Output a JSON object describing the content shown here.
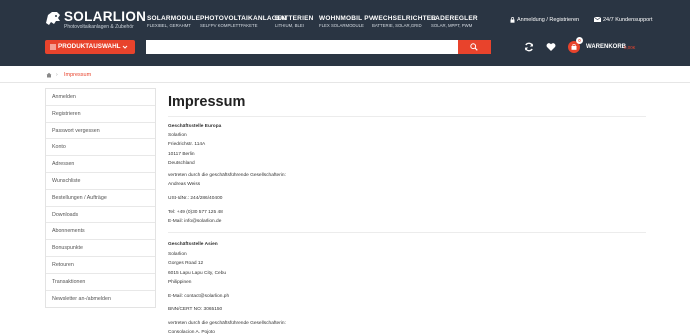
{
  "brand": {
    "name": "SOLARLION",
    "tagline": "Photovoltaikanlagen & Zubehör"
  },
  "nav": [
    {
      "title": "SOLARMODULE",
      "sub": "FLEXIBEL, GERAHMT"
    },
    {
      "title": "PHOTOVOLTAIKANLAGEN",
      "sub": "SELFPV KOMPLETTPAKETE"
    },
    {
      "title": "BATTERIEN",
      "sub": "LITHIUM, BLEI"
    },
    {
      "title": "WOHNMOBIL PV",
      "sub": "FLEX SOLARMODULE"
    },
    {
      "title": "WECHSELRICHTER",
      "sub": "BATTERIE, SOLAR,GRID"
    },
    {
      "title": "LADEREGLER",
      "sub": "SOLAR, MPPT, PWM"
    }
  ],
  "top_links": {
    "login": "Anmeldung / Registrieren",
    "support": "24/7 Kundensupport"
  },
  "toolbar": {
    "product_button": "PRODUKTAUSWAHL",
    "search_placeholder": "",
    "cart_label": "WARENKORB",
    "cart_count": "0",
    "cart_price": "0,00€"
  },
  "breadcrumb": {
    "current": "Impressum"
  },
  "sidebar": [
    "Anmelden",
    "Registrieren",
    "Passwort vergessen",
    "Konto",
    "Adressen",
    "Wunschliste",
    "Bestellungen / Aufträge",
    "Downloads",
    "Abonnements",
    "Bonuspunkte",
    "Retouren",
    "Transaktionen",
    "Newsletter an-/abmelden"
  ],
  "page": {
    "title": "Impressum",
    "europe": {
      "heading": "Geschäftsstelle Europa",
      "company": "Solarlion",
      "street": "Friedrichstr. 114A",
      "city": "10117 Berlin",
      "country": "Deutschland",
      "rep_label": "vertreten durch die geschäftsführende Gesellschafterin:",
      "rep_name": "Andreas Weiss",
      "vat": "USt-IdNr.: 244/286/40400",
      "phone": "Tel: +49 (0)30 577 125 48",
      "email": "E-Mail: info@solarlion.de"
    },
    "asia": {
      "heading": "Geschäftsstelle Asien",
      "company": "Solarlion",
      "street": "Gorges Road 12",
      "city": "6015 Lapu Lapu City, Cebu",
      "country": "Philippinen",
      "email": "E-Mail: contact@solarlion.ph",
      "bnn": "BNN/CERT NO: 3065150",
      "rep_label": "vertreten durch die geschäftsführende Gesellschafterin:",
      "rep_name": "Consolacion A. Pojoto"
    }
  },
  "colors": {
    "header_bg": "#2a3543",
    "accent": "#e8432c"
  }
}
